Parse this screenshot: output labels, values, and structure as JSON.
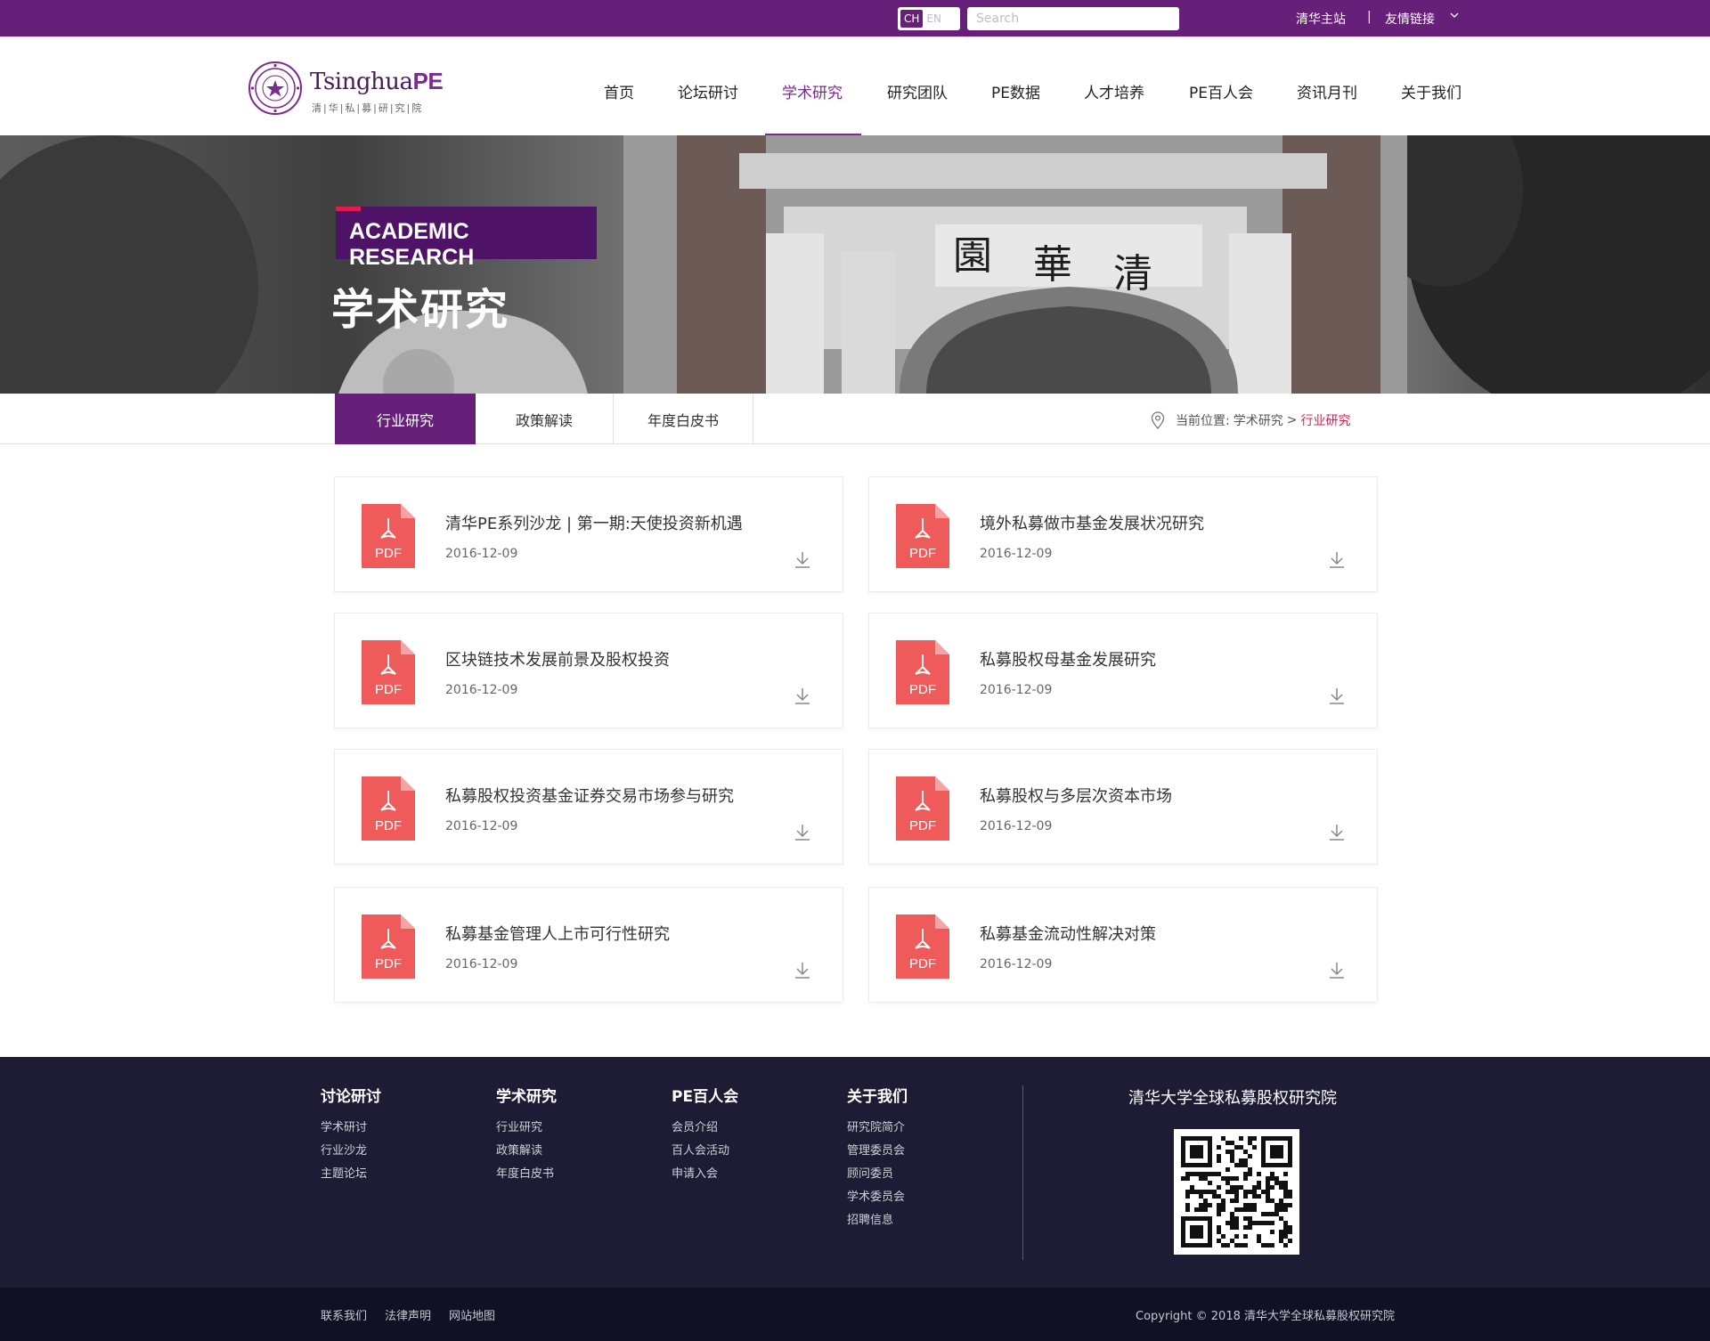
{
  "topbar": {
    "lang_ch": "CH",
    "lang_en": "EN",
    "search_placeholder": "Search",
    "main_site": "清华主站",
    "separator": "|",
    "links": "友情链接"
  },
  "logo": {
    "name": "Tsinghua",
    "name_pe": "PE",
    "subtitle": "清|华|私|募|研|究|院"
  },
  "nav": {
    "items": [
      "首页",
      "论坛研讨",
      "学术研究",
      "研究团队",
      "PE数据",
      "人才培养",
      "PE百人会",
      "资讯月刊",
      "关于我们"
    ],
    "active": "学术研究"
  },
  "banner": {
    "en_title": "ACADEMIC RESEARCH",
    "cn_title": "学术研究"
  },
  "subnav": {
    "tabs": [
      "行业研究",
      "政策解读",
      "年度白皮书"
    ],
    "active_tab": "行业研究",
    "crumb_prefix": "当前位置:",
    "crumb_parent": "学术研究",
    "crumb_sep": ">",
    "crumb_current": "行业研究"
  },
  "documents": [
    {
      "title": "清华PE系列沙龙 | 第一期:天使投资新机遇",
      "date": "2016-12-09",
      "badge": "PDF"
    },
    {
      "title": "境外私募做市基金发展状况研究",
      "date": "2016-12-09",
      "badge": "PDF"
    },
    {
      "title": "区块链技术发展前景及股权投资",
      "date": "2016-12-09",
      "badge": "PDF"
    },
    {
      "title": "私募股权母基金发展研究",
      "date": "2016-12-09",
      "badge": "PDF"
    },
    {
      "title": "私募股权投资基金证券交易市场参与研究",
      "date": "2016-12-09",
      "badge": "PDF"
    },
    {
      "title": "私募股权与多层次资本市场",
      "date": "2016-12-09",
      "badge": "PDF"
    },
    {
      "title": "私募基金管理人上市可行性研究",
      "date": "2016-12-09",
      "badge": "PDF"
    },
    {
      "title": "私募基金流动性解决对策",
      "date": "2016-12-09",
      "badge": "PDF"
    }
  ],
  "footer": {
    "columns": [
      {
        "heading": "讨论研讨",
        "links": [
          "学术研讨",
          "行业沙龙",
          "主题论坛"
        ]
      },
      {
        "heading": "学术研究",
        "links": [
          "行业研究",
          "政策解读",
          "年度白皮书"
        ]
      },
      {
        "heading": "PE百人会",
        "links": [
          "会员介绍",
          "百人会活动",
          "申请入会"
        ]
      },
      {
        "heading": "关于我们",
        "links": [
          "研究院简介",
          "管理委员会",
          "顾问委员",
          "学术委员会",
          "招聘信息"
        ]
      }
    ],
    "org_name": "清华大学全球私募股权研究院",
    "bottom_links": [
      "联系我们",
      "法律声明",
      "网站地图"
    ],
    "copyright": "Copyright © 2018 清华大学全球私募股权研究院"
  },
  "colors": {
    "brand_purple": "#66207a",
    "active_purple": "#7a2a91",
    "accent_red": "#e5194f",
    "pdf_red": "#ef5a5a",
    "footer_bg": "#1d1c34"
  },
  "icons": [
    "location-pin-icon",
    "pdf-file-icon",
    "download-icon",
    "chevron-down-icon",
    "qr-code"
  ]
}
